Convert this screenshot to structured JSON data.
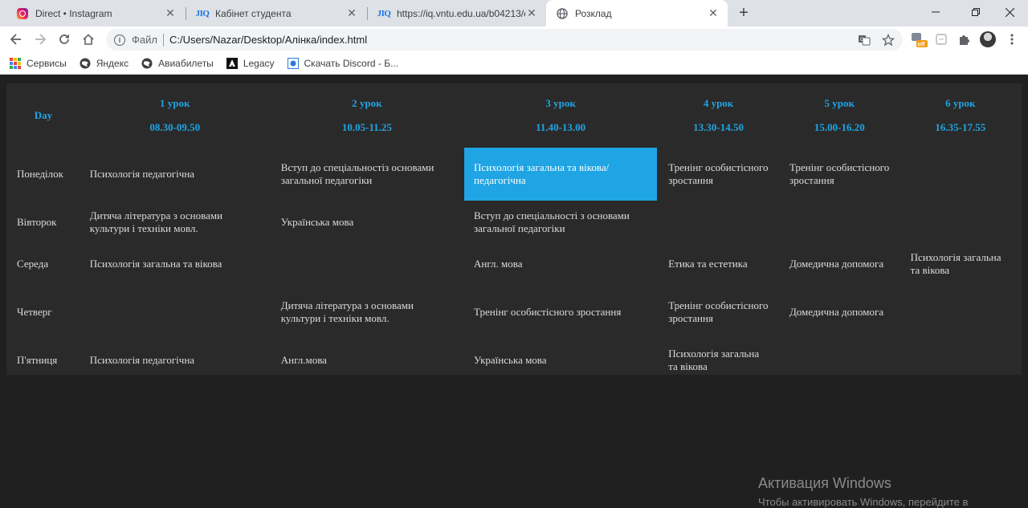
{
  "browser": {
    "tabs": [
      {
        "title": "Direct • Instagram",
        "icon": "instagram-icon"
      },
      {
        "title": "Кабінет студента",
        "icon": "jiq-icon"
      },
      {
        "title": "https://iq.vntu.edu.ua/b04213/cu",
        "icon": "jiq-icon"
      },
      {
        "title": "Розклад",
        "icon": "globe-icon"
      }
    ],
    "address": {
      "scheme": "Файл",
      "url": "C:/Users/Nazar/Desktop/Алінка/index.html"
    },
    "extension_badge": "off",
    "bookmarks": [
      {
        "label": "Сервисы",
        "icon": "apps-icon"
      },
      {
        "label": "Яндекс",
        "icon": "globe-icon"
      },
      {
        "label": "Авиабилеты",
        "icon": "globe-icon"
      },
      {
        "label": "Legacy",
        "icon": "legacy-icon"
      },
      {
        "label": "Скачать Discord - Б...",
        "icon": "discord-icon"
      }
    ]
  },
  "schedule": {
    "day_header": "Day",
    "lessons": [
      {
        "name": "1 урок",
        "time": "08.30-09.50"
      },
      {
        "name": "2 урок",
        "time": "10.05-11.25"
      },
      {
        "name": "3 урок",
        "time": "11.40-13.00"
      },
      {
        "name": "4 урок",
        "time": "13.30-14.50"
      },
      {
        "name": "5 урок",
        "time": "15.00-16.20"
      },
      {
        "name": "6 урок",
        "time": "16.35-17.55"
      }
    ],
    "rows": [
      {
        "day": "Понеділок",
        "cells": [
          "Психологія педагогічна",
          "Вступ до спеціальностіз основами загальної педагогіки",
          "Психологія загальна та вікова/ педагогічна",
          "Тренінг особистісного зростання",
          "Тренінг особистісного зростання",
          ""
        ]
      },
      {
        "day": "Вівторок",
        "cells": [
          "Дитяча література з основами культури і техніки мовл.",
          "Українська мова",
          "Вступ до спеціальності з основами загальної педагогіки",
          "",
          "",
          ""
        ]
      },
      {
        "day": "Середа",
        "cells": [
          "Психологія загальна та вікова",
          "",
          "Англ. мова",
          "Етика та естетика",
          "Домедична допомога",
          "Психологія загальна та вікова"
        ]
      },
      {
        "day": "Четверг",
        "cells": [
          "",
          "Дитяча література з основами культури і техніки мовл.",
          "Тренінг особистісного зростання",
          "Тренінг особистісного зростання",
          "Домедична допомога",
          ""
        ]
      },
      {
        "day": "П'ятниця",
        "cells": [
          "Психологія педагогічна",
          "Англ.мова",
          "Українська мова",
          "Психологія загальна та вікова",
          "",
          ""
        ]
      }
    ],
    "highlight_color": "#1fa4e4"
  },
  "watermark": {
    "title": "Активация Windows",
    "subtitle": "Чтобы активировать Windows, перейдите в"
  }
}
